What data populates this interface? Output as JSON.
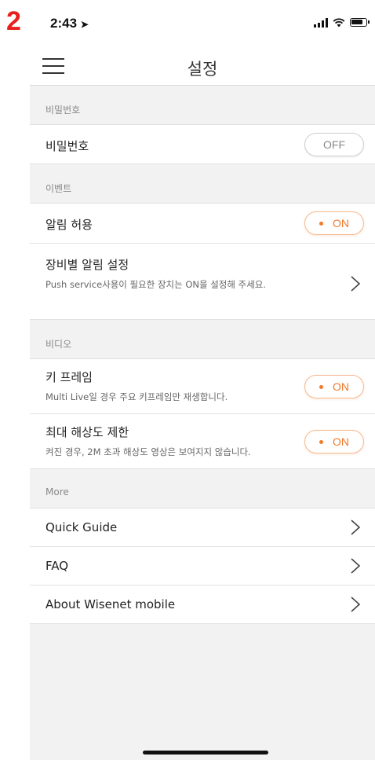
{
  "step_number": "2",
  "status": {
    "time": "2:43"
  },
  "nav": {
    "title": "설정"
  },
  "sections": {
    "password": {
      "header": "비밀번호",
      "password_row": {
        "title": "비밀번호",
        "toggle": "OFF"
      }
    },
    "event": {
      "header": "이벤트",
      "alarm_row": {
        "title": "알림 허용",
        "toggle": "ON"
      },
      "device_alarm_row": {
        "title": "장비별 알림 설정",
        "subtitle": "Push service사용이 필요한 장치는 ON을 설정해 주세요."
      }
    },
    "video": {
      "header": "비디오",
      "keyframe_row": {
        "title": "키 프레임",
        "subtitle": "Multi Live일 경우 주요 키프레임만 재생합니다.",
        "toggle": "ON"
      },
      "max_resolution_row": {
        "title": "최대 해상도 제한",
        "subtitle": "켜진 경우, 2M 초과 해상도 영상은 보여지지 않습니다.",
        "toggle": "ON"
      }
    },
    "more": {
      "header": "More",
      "items": [
        "Quick Guide",
        "FAQ",
        "About Wisenet mobile"
      ]
    }
  },
  "colors": {
    "accent": "#f07a2a",
    "background": "#f2f2f2"
  }
}
